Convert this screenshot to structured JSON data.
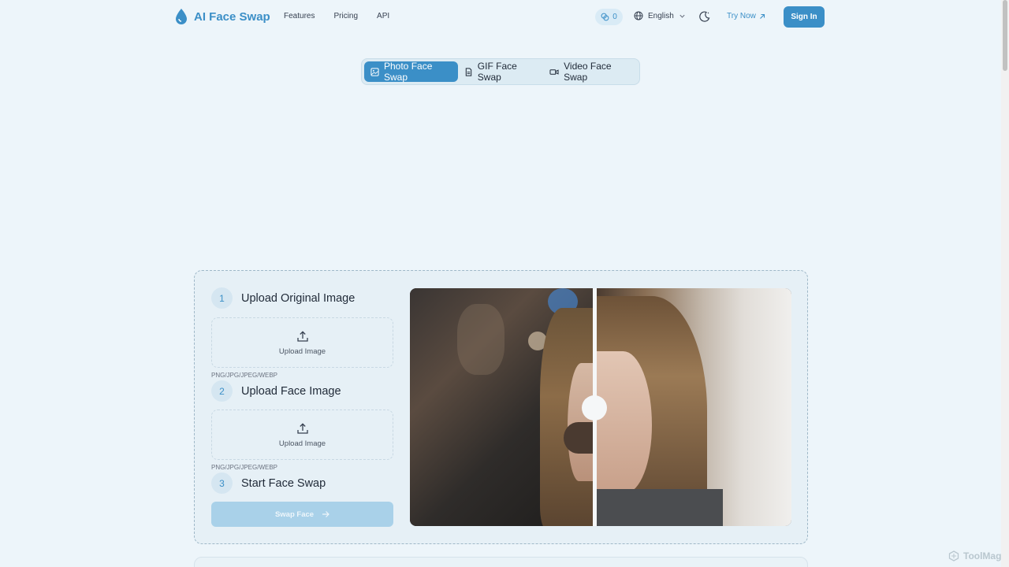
{
  "header": {
    "brand": "AI Face Swap",
    "nav": [
      "Features",
      "Pricing",
      "API"
    ],
    "credits": "0",
    "language": "English",
    "try_now": "Try Now",
    "sign_in": "Sign In"
  },
  "tabs": [
    {
      "label": "Photo Face Swap",
      "icon": "image-icon",
      "active": true
    },
    {
      "label": "GIF Face Swap",
      "icon": "file-icon",
      "active": false
    },
    {
      "label": "Video Face Swap",
      "icon": "video-icon",
      "active": false
    }
  ],
  "steps": [
    {
      "number": "1",
      "title": "Upload Original Image",
      "upload_label": "Upload Image",
      "formats": "PNG/JPG/JPEG/WEBP"
    },
    {
      "number": "2",
      "title": "Upload Face Image",
      "upload_label": "Upload Image",
      "formats": "PNG/JPG/JPEG/WEBP"
    },
    {
      "number": "3",
      "title": "Start Face Swap"
    }
  ],
  "swap_button": "Swap Face",
  "watermark": "ToolMage",
  "colors": {
    "accent": "#3b8fc7",
    "background": "#edf5fa",
    "disabled_button": "#a9d1e9"
  }
}
